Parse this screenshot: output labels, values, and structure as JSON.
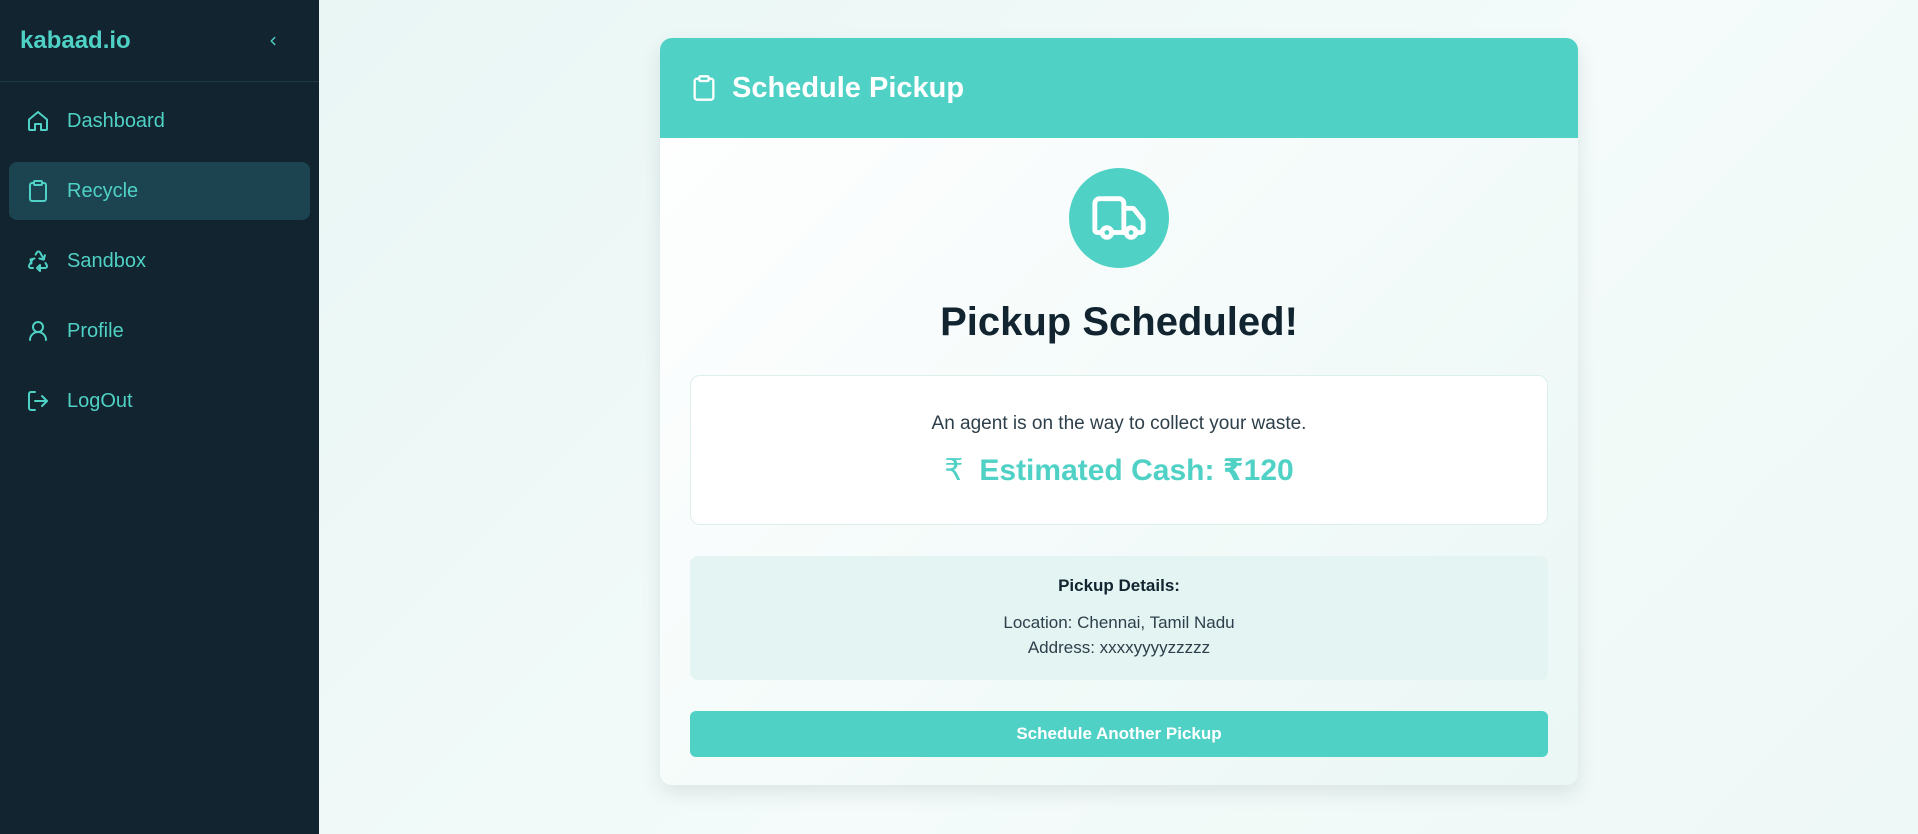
{
  "sidebar": {
    "brand": "kabaad.io",
    "items": [
      {
        "label": "Dashboard",
        "icon": "home-icon",
        "active": false
      },
      {
        "label": "Recycle",
        "icon": "clipboard-icon",
        "active": true
      },
      {
        "label": "Sandbox",
        "icon": "recycle-icon",
        "active": false
      },
      {
        "label": "Profile",
        "icon": "user-icon",
        "active": false
      },
      {
        "label": "LogOut",
        "icon": "logout-icon",
        "active": false
      }
    ]
  },
  "card": {
    "title": "Schedule Pickup",
    "success_title": "Pickup Scheduled!",
    "message": "An agent is on the way to collect your waste.",
    "cash_symbol": "₹",
    "cash_text": "Estimated Cash: ₹120",
    "details": {
      "title": "Pickup Details:",
      "location": "Location: Chennai, Tamil Nadu",
      "address": "Address: xxxxyyyyzzzzz"
    },
    "action_label": "Schedule Another Pickup"
  },
  "colors": {
    "accent": "#4fd1c5",
    "sidebar_bg": "#11242f",
    "active_item_bg": "#1c4450",
    "text_dark": "#11242f"
  }
}
